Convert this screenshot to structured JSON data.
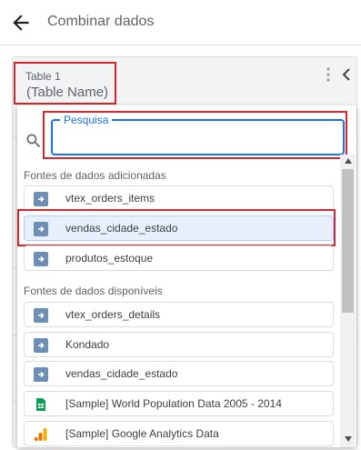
{
  "header": {
    "title": "Combinar dados",
    "back_icon": "arrow-left-icon"
  },
  "table": {
    "label": "Table 1",
    "name": "(Table Name)"
  },
  "search": {
    "legend": "Pesquisa",
    "value": "",
    "placeholder": ""
  },
  "sections": {
    "added": {
      "title": "Fontes de dados adicionadas",
      "items": [
        {
          "label": "vtex_orders_items",
          "icon": "data-source-icon"
        },
        {
          "label": "vendas_cidade_estado",
          "icon": "data-source-icon",
          "selected": true
        },
        {
          "label": "produtos_estoque",
          "icon": "data-source-icon"
        }
      ]
    },
    "available": {
      "title": "Fontes de dados disponíveis",
      "items": [
        {
          "label": "vtex_orders_details",
          "icon": "data-source-icon"
        },
        {
          "label": "Kondado",
          "icon": "data-source-icon"
        },
        {
          "label": "vendas_cidade_estado",
          "icon": "data-source-icon"
        },
        {
          "label": "[Sample] World Population Data 2005 - 2014",
          "icon": "google-sheets-icon"
        },
        {
          "label": "[Sample] Google Analytics Data",
          "icon": "google-analytics-icon"
        }
      ]
    }
  },
  "colors": {
    "accent": "#1a73e8",
    "highlight": "#d7262e",
    "selected_bg": "#e8f0fe"
  }
}
